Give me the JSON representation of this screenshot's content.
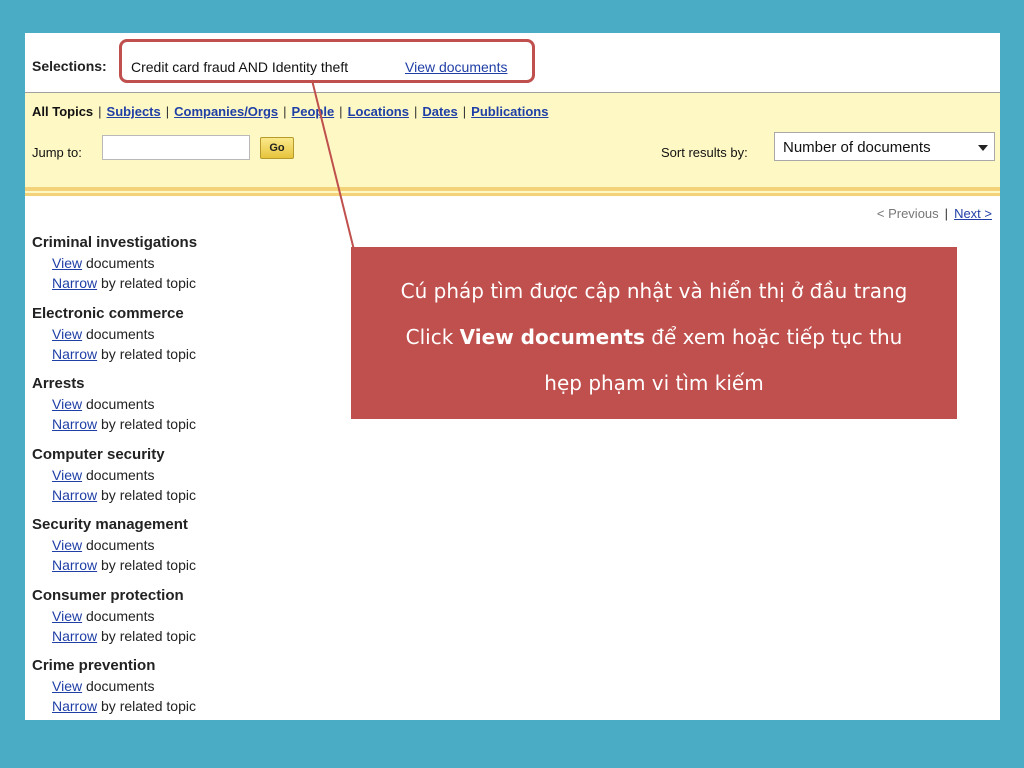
{
  "selections": {
    "label": "Selections:",
    "query": "Credit card fraud AND Identity theft",
    "view_link": "View documents"
  },
  "topics": {
    "all_label": "All Topics",
    "links": [
      "Subjects",
      "Companies/Orgs",
      "People",
      "Locations",
      "Dates",
      "Publications"
    ]
  },
  "jump": {
    "label": "Jump to:",
    "value": "",
    "go_label": "Go"
  },
  "sort": {
    "label": "Sort results by:",
    "selected": "Number of documents"
  },
  "pager": {
    "previous": "< Previous",
    "next": "Next >"
  },
  "results": [
    {
      "title": "Criminal investigations",
      "view": "View",
      "view_suffix": " documents",
      "narrow": "Narrow",
      "narrow_suffix": " by related topic"
    },
    {
      "title": "Electronic commerce",
      "view": "View",
      "view_suffix": " documents",
      "narrow": "Narrow",
      "narrow_suffix": " by related topic"
    },
    {
      "title": "Arrests",
      "view": "View",
      "view_suffix": " documents",
      "narrow": "Narrow",
      "narrow_suffix": " by related topic"
    },
    {
      "title": "Computer security",
      "view": "View",
      "view_suffix": " documents",
      "narrow": "Narrow",
      "narrow_suffix": " by related topic"
    },
    {
      "title": "Security management",
      "view": "View",
      "view_suffix": " documents",
      "narrow": "Narrow",
      "narrow_suffix": " by related topic"
    },
    {
      "title": "Consumer protection",
      "view": "View",
      "view_suffix": " documents",
      "narrow": "Narrow",
      "narrow_suffix": " by related topic"
    },
    {
      "title": "Crime prevention",
      "view": "View",
      "view_suffix": " documents",
      "narrow": "Narrow",
      "narrow_suffix": " by related topic"
    }
  ],
  "callout": {
    "line1": "Cú pháp tìm được cập nhật và hiển thị ở đầu trang",
    "line2_prefix": "Click ",
    "line2_bold": "View documents",
    "line2_suffix": " để xem hoặc tiếp tục thu",
    "line3": "hẹp phạm vi tìm kiếm"
  },
  "colors": {
    "slide_background": "#4aacc5",
    "callout_background": "#c0504d",
    "highlight_border": "#c0504d",
    "panel_background": "#fdf8c4",
    "link": "#1f3fa6"
  }
}
